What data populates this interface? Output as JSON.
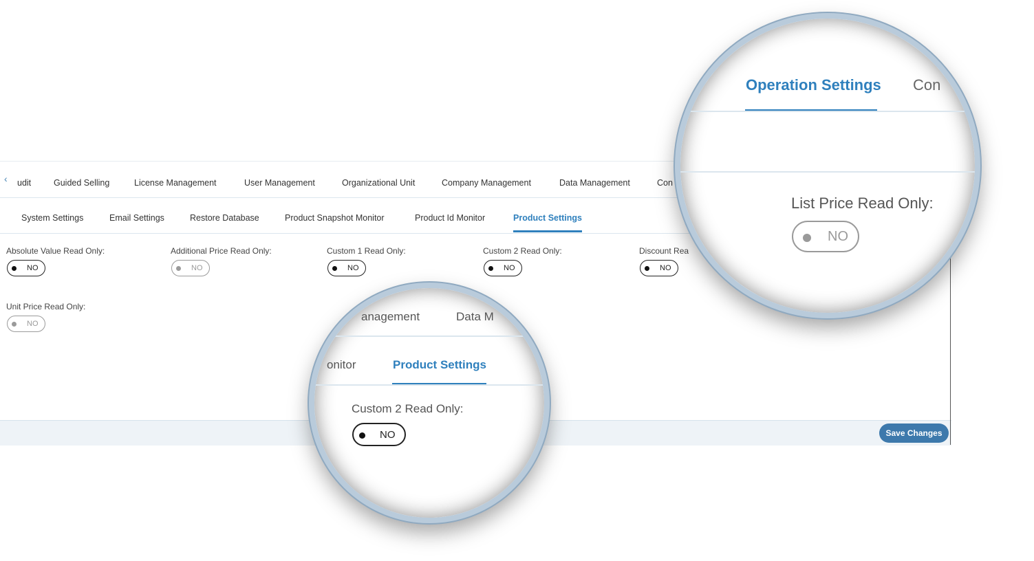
{
  "nav_primary": {
    "tabs": [
      "udit",
      "Guided Selling",
      "License Management",
      "User Management",
      "Organizational Unit",
      "Company Management",
      "Data Management",
      "Con"
    ]
  },
  "nav_secondary": {
    "tabs": [
      "System Settings",
      "Email Settings",
      "Restore Database",
      "Product Snapshot Monitor",
      "Product Id Monitor",
      "Product Settings"
    ],
    "active": "Product Settings"
  },
  "fields": [
    {
      "label": "Absolute Value Read Only:",
      "value": "NO",
      "disabled": false
    },
    {
      "label": "Additional Price Read Only:",
      "value": "NO",
      "disabled": true
    },
    {
      "label": "Custom 1 Read Only:",
      "value": "NO",
      "disabled": false
    },
    {
      "label": "Custom 2 Read Only:",
      "value": "NO",
      "disabled": false
    },
    {
      "label": "Discount Rea",
      "value": "NO",
      "disabled": false
    },
    {
      "label": "Unit Price Read Only:",
      "value": "NO",
      "disabled": true
    }
  ],
  "footer": {
    "save_label": "Save Changes"
  },
  "zoom_large": {
    "tab_active": "Operation Settings",
    "tab_next": "Con",
    "field_label": "List Price Read Only:",
    "field_value": "NO"
  },
  "zoom_small": {
    "tab_a": "anagement",
    "tab_b": "Data M",
    "tab_c": "onitor",
    "tab_active": "Product Settings",
    "field_label": "Custom 2 Read Only:",
    "field_value": "NO"
  },
  "colors": {
    "accent": "#2f80bd",
    "button": "#3d79ac",
    "footer_bg": "#eef3f7"
  }
}
